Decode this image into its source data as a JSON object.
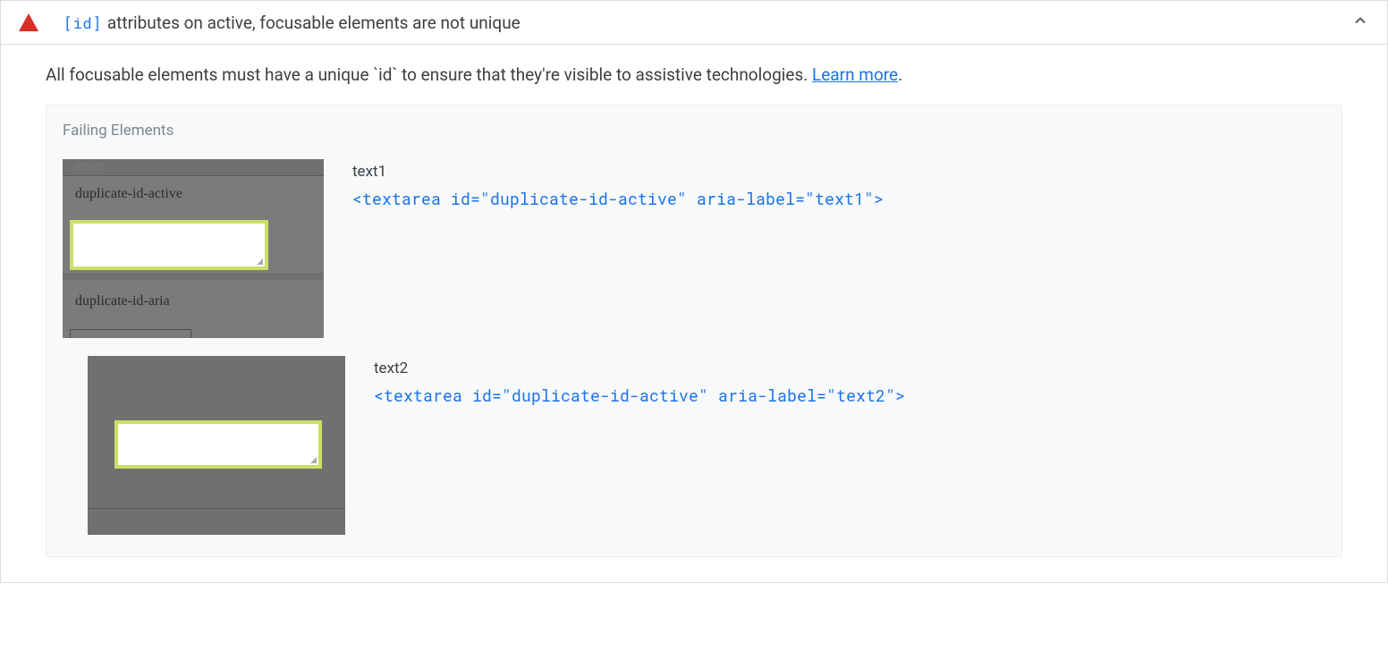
{
  "audit": {
    "code_chip": "[id]",
    "title_suffix": " attributes on active, focusable elements are not unique",
    "description_prefix": "All focusable elements must have a unique ",
    "description_code": "`id`",
    "description_suffix": " to ensure that they're visible to assistive technologies. ",
    "learn_more": "Learn more",
    "desc_period": "."
  },
  "details": {
    "section_title": "Failing Elements",
    "items": [
      {
        "thumb": {
          "top_cut": "ditem",
          "label1": "duplicate-id-active",
          "label2": "duplicate-id-aria"
        },
        "node_label": "text1",
        "node_html": "<textarea id=\"duplicate-id-active\" aria-label=\"text1\">"
      },
      {
        "node_label": "text2",
        "node_html": "<textarea id=\"duplicate-id-active\" aria-label=\"text2\">"
      }
    ]
  }
}
